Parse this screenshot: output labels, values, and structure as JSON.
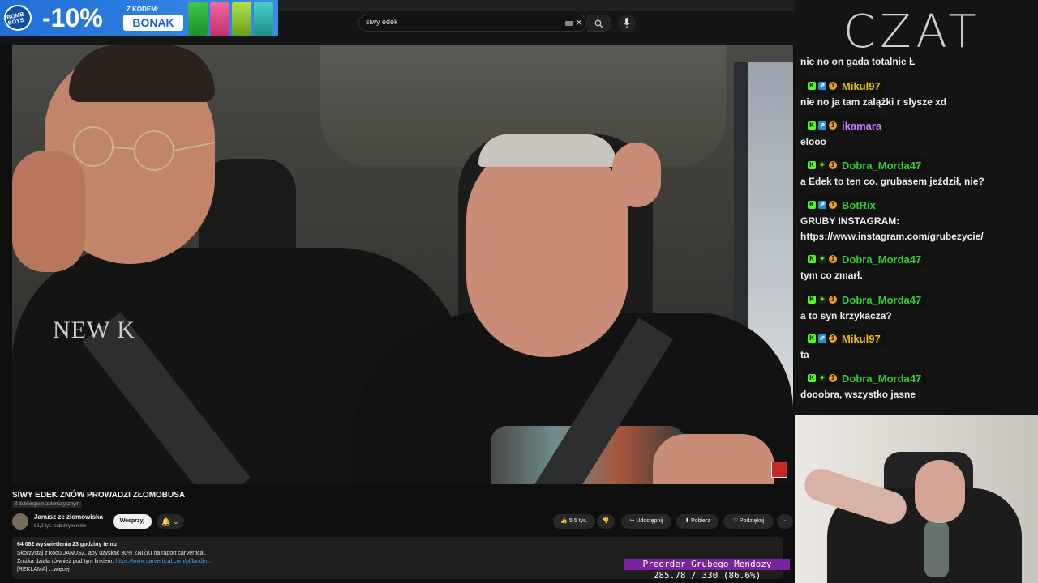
{
  "ad": {
    "logo_text": "BOMB BOYS",
    "discount": "-10%",
    "code_label": "Z KODEM:",
    "code": "BONAK"
  },
  "search": {
    "query": "siwy edek"
  },
  "video": {
    "title": "SIWY EDEK ZNÓW PROWADZI ZŁOMOBUSA",
    "dub_label": "Z dubbingiem automatycznym",
    "shirt_text": "NEW  K",
    "channel": {
      "name": "Janusz ze złomowiska",
      "subscribers": "81,2 tys. subskrybentów"
    },
    "support_label": "Wesprzyj",
    "bell_label": "🔔 ⌄",
    "actions": {
      "likes": "👍 5,5 tys.",
      "dislike": "👎",
      "share": "↪ Udostępnij",
      "download": "⬇ Pobierz",
      "thanks": "♡ Podziękuj",
      "more": "⋯"
    },
    "description": {
      "stats": "64 082 wyświetlenia  23 godziny temu",
      "line1": "Skorzystaj z kodu JANUSZ, aby uzyskać 30% ZNIŻKI na raport carVertical.",
      "line2_text": "Zniżka działa również pod tym linkiem: ",
      "line2_link": "https://www.carvertical.com/pl/landin...",
      "line3": "[REKLAMA] ...więcej"
    }
  },
  "chat": {
    "header": "CZAT",
    "first_message": "nie no on gada totalnie Ł",
    "messages": [
      {
        "nick": "Mikul97",
        "color": "#e6c200",
        "text": "nie no ja tam zalążki r slysze xd"
      },
      {
        "nick": "ikamara",
        "color": "#c77dff",
        "text": "elooo"
      },
      {
        "nick": "Dobra_Morda47",
        "color": "#33cc33",
        "text": "a Edek to ten co. grubasem jeździł, nie?"
      },
      {
        "nick": "BotRix",
        "color": "#33cc33",
        "text": "GRUBY INSTAGRAM:"
      },
      {
        "nick": "Dobra_Morda47",
        "color": "#33cc33",
        "text": "tym co zmarł."
      },
      {
        "nick": "Dobra_Morda47",
        "color": "#33cc33",
        "text": "a to syn krzykacza?"
      },
      {
        "nick": "Mikul97",
        "color": "#e6c200",
        "text": "ta"
      },
      {
        "nick": "Dobra_Morda47",
        "color": "#33cc33",
        "text": "dooobra, wszystko jasne"
      }
    ],
    "botrix_link": "https://www.instagram.com/grubezycie/"
  },
  "overlay": {
    "preorder": "Preorder Grubego Mendozy",
    "progress": "285.78 / 330 (86.6%)"
  }
}
